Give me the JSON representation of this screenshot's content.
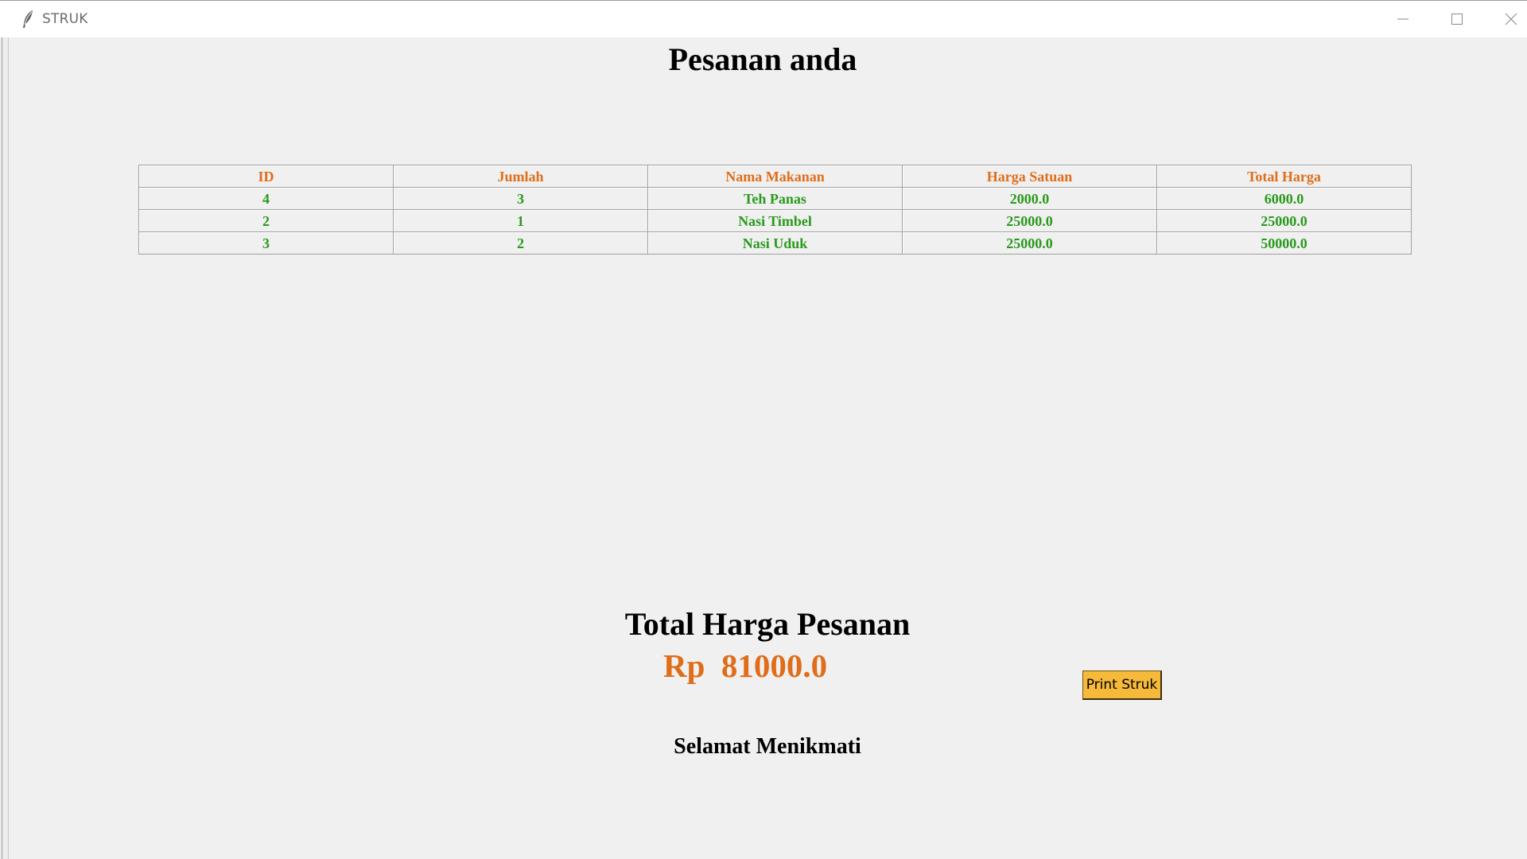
{
  "window": {
    "title": "STRUK",
    "icons": {
      "app": "feather-icon",
      "minimize": "minimize-icon",
      "maximize": "maximize-icon",
      "close": "close-icon"
    }
  },
  "main": {
    "heading": "Pesanan anda",
    "table": {
      "headers": [
        "ID",
        "Jumlah",
        "Nama Makanan",
        "Harga Satuan",
        "Total Harga"
      ],
      "rows": [
        [
          "4",
          "3",
          "Teh Panas",
          "2000.0",
          "6000.0"
        ],
        [
          "2",
          "1",
          "Nasi Timbel",
          "25000.0",
          "25000.0"
        ],
        [
          "3",
          "2",
          "Nasi Uduk",
          "25000.0",
          "50000.0"
        ]
      ]
    },
    "total_label": "Total Harga Pesanan",
    "total_value": "Rp  81000.0",
    "print_button": "Print Struk",
    "closing": "Selamat Menikmati"
  },
  "colors": {
    "header_text": "#e06d1a",
    "cell_text": "#2a9a1d",
    "total_value": "#e06d1a",
    "button_bg": "#f6b93a",
    "background": "#f0f0f0"
  }
}
